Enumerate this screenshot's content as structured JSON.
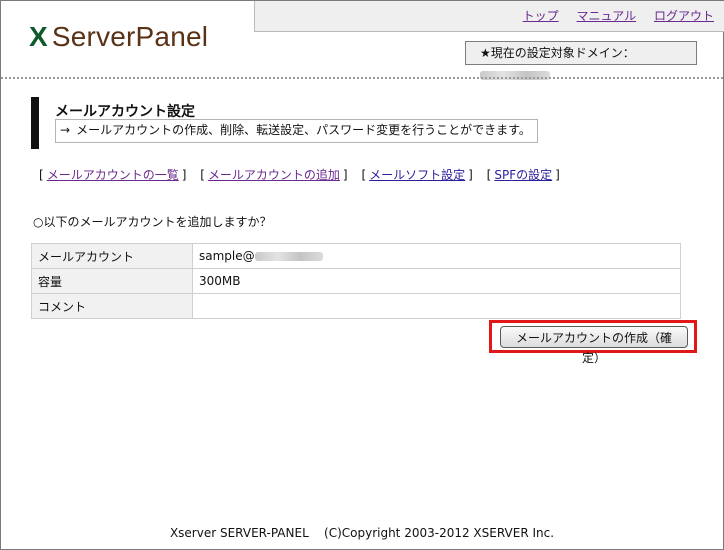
{
  "header": {
    "logo_mark": "X",
    "logo_text": "ServerPanel",
    "nav": [
      "トップ",
      "マニュアル",
      "ログアウト"
    ],
    "domain_label": "★現在の設定対象ドメイン："
  },
  "section": {
    "title": "メールアカウント設定",
    "arrow": "→",
    "description": "メールアカウントの作成、削除、転送設定、パスワード変更を行うことができます。"
  },
  "submenu": {
    "open": "[",
    "close": "]",
    "items": [
      "メールアカウントの一覧",
      "メールアカウントの追加",
      "メールソフト設定",
      "SPFの設定"
    ]
  },
  "question": "○以下のメールアカウントを追加しますか？",
  "table": {
    "rows": [
      {
        "label": "メールアカウント",
        "value": "sample@"
      },
      {
        "label": "容量",
        "value": "300MB"
      },
      {
        "label": "コメント",
        "value": ""
      }
    ]
  },
  "confirm_button": "メールアカウントの作成（確定）",
  "footer": "Xserver SERVER-PANEL    (C)Copyright 2003-2012 XSERVER Inc.",
  "colors": {
    "highlight": "#e01818",
    "logo_brown": "#5a3216",
    "logo_green": "#0f5a2c"
  }
}
